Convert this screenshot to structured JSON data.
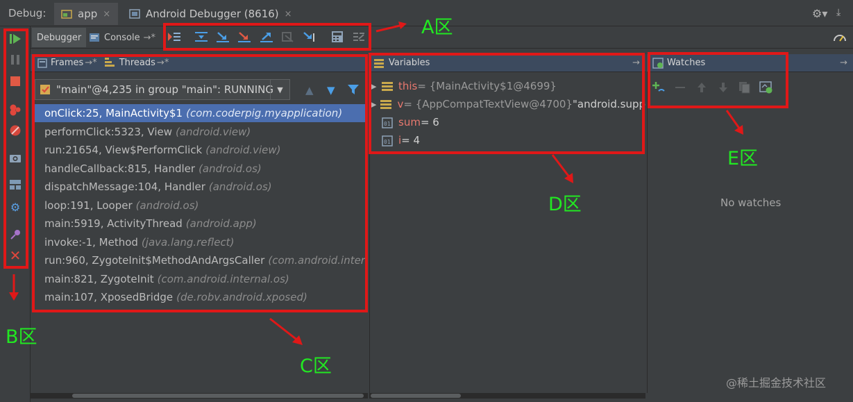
{
  "header": {
    "debug_label": "Debug:",
    "tabs": [
      {
        "label": "app",
        "close": "×"
      },
      {
        "label": "Android Debugger (8616)",
        "close": "×"
      }
    ]
  },
  "subtabs": {
    "debugger": "Debugger",
    "console": "Console",
    "console_pin": "→*"
  },
  "frames_panel": {
    "frames_tab": "Frames",
    "frames_pin": "→*",
    "threads_tab": "Threads",
    "threads_pin": "→*",
    "thread_selector": "\"main\"@4,235 in group \"main\": RUNNING",
    "frames": [
      {
        "method": "onClick:25, MainActivity$1",
        "package": "(com.coderpig.myapplication)"
      },
      {
        "method": "performClick:5323, View",
        "package": "(android.view)"
      },
      {
        "method": "run:21654, View$PerformClick",
        "package": "(android.view)"
      },
      {
        "method": "handleCallback:815, Handler",
        "package": "(android.os)"
      },
      {
        "method": "dispatchMessage:104, Handler",
        "package": "(android.os)"
      },
      {
        "method": "loop:191, Looper",
        "package": "(android.os)"
      },
      {
        "method": "main:5919, ActivityThread",
        "package": "(android.app)"
      },
      {
        "method": "invoke:-1, Method",
        "package": "(java.lang.reflect)"
      },
      {
        "method": "run:960, ZygoteInit$MethodAndArgsCaller",
        "package": "(com.android.intern"
      },
      {
        "method": "main:821, ZygoteInit",
        "package": "(com.android.internal.os)"
      },
      {
        "method": "main:107, XposedBridge",
        "package": "(de.robv.android.xposed)"
      }
    ]
  },
  "variables_panel": {
    "title": "Variables",
    "pin": "→",
    "vars": [
      {
        "name": "this",
        "value": " = {MainActivity$1@4699}",
        "extra": ""
      },
      {
        "name": "v",
        "value": " = {AppCompatTextView@4700} ",
        "extra": "\"android.supp"
      },
      {
        "name": "sum",
        "value": " = 6",
        "extra": ""
      },
      {
        "name": "i",
        "value": " = 4",
        "extra": ""
      }
    ]
  },
  "watches_panel": {
    "title": "Watches",
    "pin": "→",
    "empty_text": "No watches"
  },
  "annotations": {
    "zone_a": "A区",
    "zone_b": "B区",
    "zone_c": "C区",
    "zone_d": "D区",
    "zone_e": "E区",
    "box_color": "#e01818",
    "label_color": "#22e822"
  },
  "watermark": "@稀土掘金技术社区",
  "colors": {
    "selection": "#4b6eaf",
    "panel_header": "#3c4a5e",
    "background": "#3c3f41"
  }
}
